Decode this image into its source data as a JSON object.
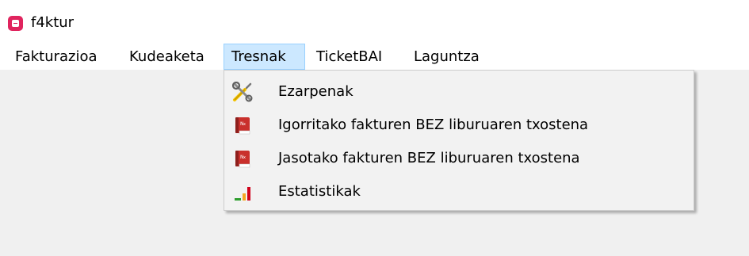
{
  "app": {
    "title": "f4ktur",
    "icon": "app-logo-icon"
  },
  "menubar": {
    "items": [
      {
        "label": "Fakturazioa"
      },
      {
        "label": "Kudeaketa"
      },
      {
        "label": "Tresnak"
      },
      {
        "label": "TicketBAI"
      },
      {
        "label": "Laguntza"
      }
    ],
    "active": "Tresnak"
  },
  "dropdown": {
    "items": [
      {
        "label": "Ezarpenak",
        "icon": "tools-icon"
      },
      {
        "label": "Igorritako fakturen BEZ liburuaren txostena",
        "icon": "report-book-icon"
      },
      {
        "label": "Jasotako fakturen BEZ liburuaren txostena",
        "icon": "report-book-icon"
      },
      {
        "label": "Estatistikak",
        "icon": "statistics-icon"
      }
    ]
  },
  "colors": {
    "app_icon": "#e0245e",
    "menu_active_bg": "#cce8ff",
    "menu_active_border": "#99d1ff",
    "dropdown_bg": "#f2f2f2",
    "workspace_bg": "#f0f0f0"
  }
}
